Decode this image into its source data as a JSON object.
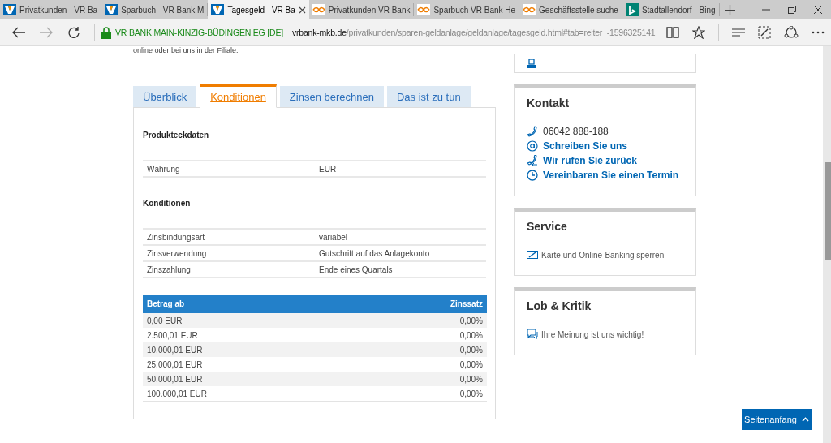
{
  "browser": {
    "tabs": [
      {
        "title": "Privatkunden - VR Ba",
        "kind": "vr",
        "selected": false
      },
      {
        "title": "Sparbuch - VR Bank M",
        "kind": "vr",
        "selected": false
      },
      {
        "title": "Tagesgeld - VR Ba",
        "kind": "vr",
        "selected": true
      },
      {
        "title": "Privatkunden VR Bank",
        "kind": "swirl",
        "selected": false
      },
      {
        "title": "Sparbuch VR Bank He",
        "kind": "swirl",
        "selected": false
      },
      {
        "title": "Geschäftsstelle suche",
        "kind": "swirl",
        "selected": false
      },
      {
        "title": "Stadtallendorf - Bing",
        "kind": "bing",
        "selected": false
      }
    ],
    "address": {
      "identity": "VR BANK MAIN-KINZIG-BÜDINGEN EG [DE]",
      "domain": "vrbank-mkb.de",
      "path": "/privatkunden/sparen-geldanlage/geldanlage/tagesgeld.html#tab=reiter_-1596325141"
    }
  },
  "intro": "online oder bei uns in der Filiale.",
  "content_tabs": [
    {
      "label": "Überblick",
      "selected": false
    },
    {
      "label": "Konditionen",
      "selected": true
    },
    {
      "label": "Zinsen berechnen",
      "selected": false
    },
    {
      "label": "Das ist zu tun",
      "selected": false
    }
  ],
  "sections": [
    {
      "heading": "Produkteckdaten",
      "rows": [
        {
          "label": "Währung",
          "value": "EUR"
        }
      ]
    },
    {
      "heading": "Konditionen",
      "rows": [
        {
          "label": "Zinsbindungsart",
          "value": "variabel"
        },
        {
          "label": "Zinsverwendung",
          "value": "Gutschrift auf das Anlagekonto"
        },
        {
          "label": "Zinszahlung",
          "value": "Ende eines Quartals"
        }
      ]
    }
  ],
  "rate_table": {
    "columns": [
      "Betrag ab",
      "Zinssatz"
    ],
    "rows": [
      {
        "amount": "0,00 EUR",
        "rate": "0,00%"
      },
      {
        "amount": "2.500,01 EUR",
        "rate": "0,00%"
      },
      {
        "amount": "10.000,01 EUR",
        "rate": "0,00%"
      },
      {
        "amount": "25.000,01 EUR",
        "rate": "0,00%"
      },
      {
        "amount": "50.000,01 EUR",
        "rate": "0,00%"
      },
      {
        "amount": "100.000,01 EUR",
        "rate": "0,00%"
      }
    ]
  },
  "sidebar": [
    {
      "kind": "print"
    },
    {
      "kind": "card",
      "title": "Kontakt",
      "items": [
        {
          "kind": "phone",
          "text": "06042 888-188",
          "link": false
        },
        {
          "kind": "mail",
          "text": "Schreiben Sie uns",
          "link": true
        },
        {
          "kind": "callback",
          "text": "Wir rufen Sie zurück",
          "link": true
        },
        {
          "kind": "appointment",
          "text": "Vereinbaren Sie einen Termin",
          "link": true
        }
      ]
    },
    {
      "kind": "card",
      "title": "Service",
      "items": [
        {
          "kind": "block",
          "text": "Karte und Online-Banking sperren",
          "link": false
        }
      ]
    },
    {
      "kind": "card",
      "title": "Lob & Kritik",
      "items": [
        {
          "kind": "feedback",
          "text": "Ihre Meinung ist uns wichtig!",
          "link": false
        }
      ]
    }
  ],
  "back_to_top": "Seitenanfang"
}
